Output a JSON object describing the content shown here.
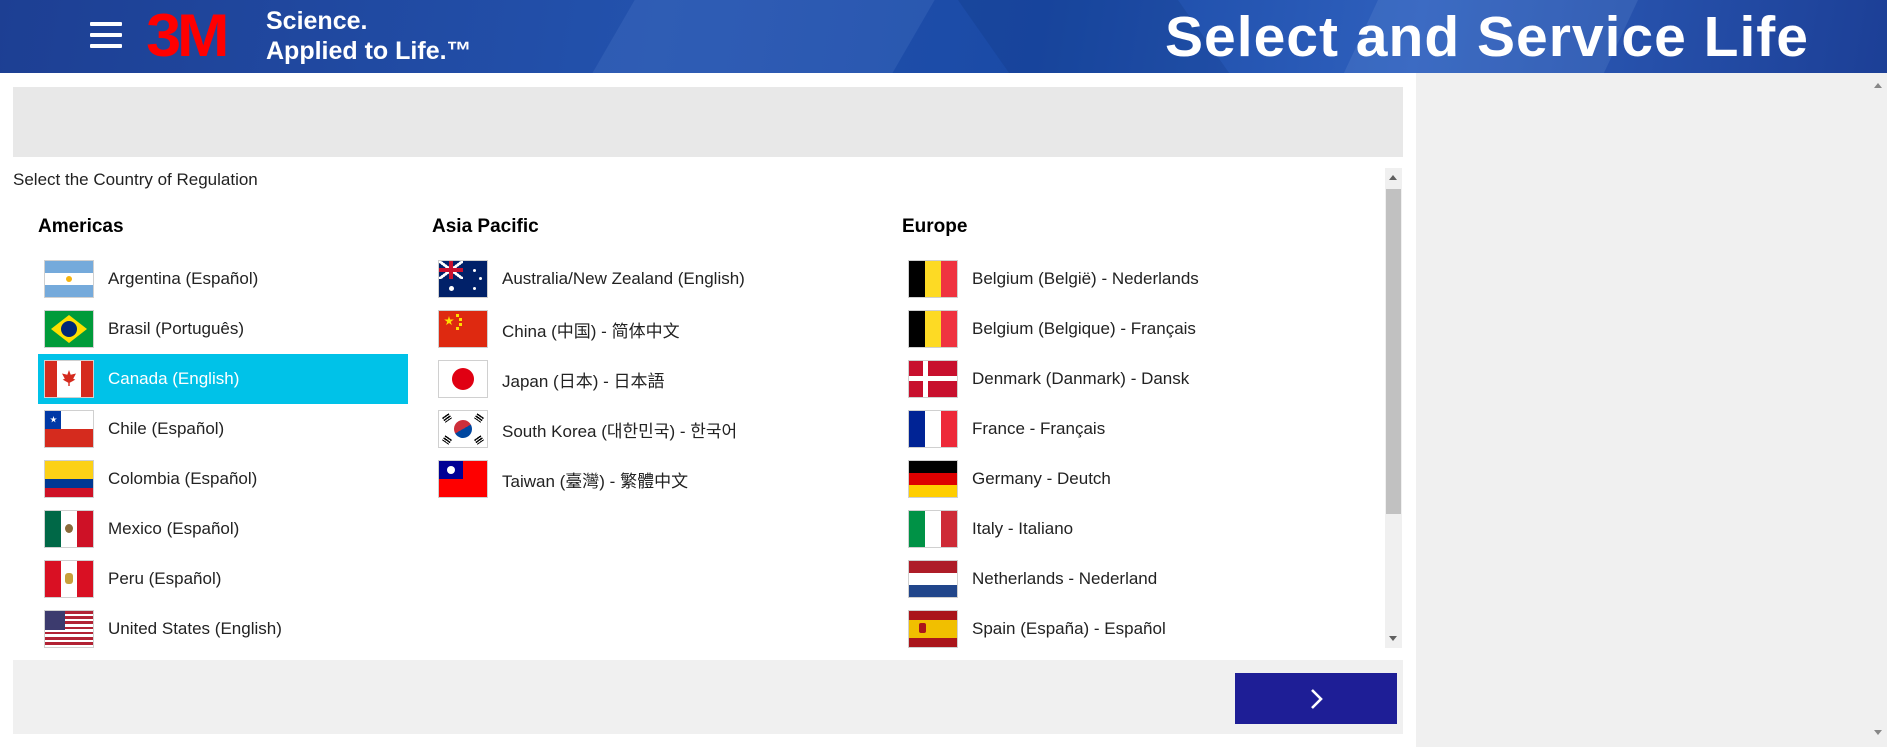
{
  "header": {
    "logo_text": "3M",
    "tagline_line1": "Science.",
    "tagline_line2": "Applied to Life.™",
    "app_title": "Select and Service Life",
    "brand_color": "#ff0000",
    "header_color": "#1d3f93"
  },
  "prompt": "Select the Country of Regulation",
  "regions": [
    {
      "name": "Americas",
      "items": [
        {
          "label": "Argentina (Español)",
          "flag": "argentina-flag"
        },
        {
          "label": "Brasil (Português)",
          "flag": "brazil-flag"
        },
        {
          "label": "Canada (English)",
          "flag": "canada-flag",
          "selected": true
        },
        {
          "label": "Chile (Español)",
          "flag": "chile-flag"
        },
        {
          "label": "Colombia (Español)",
          "flag": "colombia-flag"
        },
        {
          "label": "Mexico (Español)",
          "flag": "mexico-flag"
        },
        {
          "label": "Peru (Español)",
          "flag": "peru-flag"
        },
        {
          "label": "United States (English)",
          "flag": "usa-flag"
        }
      ]
    },
    {
      "name": "Asia Pacific",
      "items": [
        {
          "label": "Australia/New Zealand (English)",
          "flag": "australia-flag"
        },
        {
          "label": "China (中国) - 简体中文",
          "flag": "china-flag"
        },
        {
          "label": "Japan (日本) - 日本語",
          "flag": "japan-flag"
        },
        {
          "label": "South Korea (대한민국) - 한국어",
          "flag": "south-korea-flag"
        },
        {
          "label": "Taiwan (臺灣) - 繁體中文",
          "flag": "taiwan-flag"
        }
      ]
    },
    {
      "name": "Europe",
      "items": [
        {
          "label": "Belgium (België) - Nederlands",
          "flag": "belgium-flag"
        },
        {
          "label": "Belgium (Belgique) - Français",
          "flag": "belgium-flag"
        },
        {
          "label": "Denmark (Danmark) - Dansk",
          "flag": "denmark-flag"
        },
        {
          "label": "France - Français",
          "flag": "france-flag"
        },
        {
          "label": "Germany - Deutch",
          "flag": "germany-flag"
        },
        {
          "label": "Italy - Italiano",
          "flag": "italy-flag"
        },
        {
          "label": "Netherlands - Nederland",
          "flag": "netherlands-flag"
        },
        {
          "label": "Spain (España) - Español",
          "flag": "spain-flag"
        }
      ]
    }
  ],
  "selected_color": "#00c2e8",
  "next_button": {
    "icon": "chevron-right-icon",
    "color": "#1e1e96"
  }
}
